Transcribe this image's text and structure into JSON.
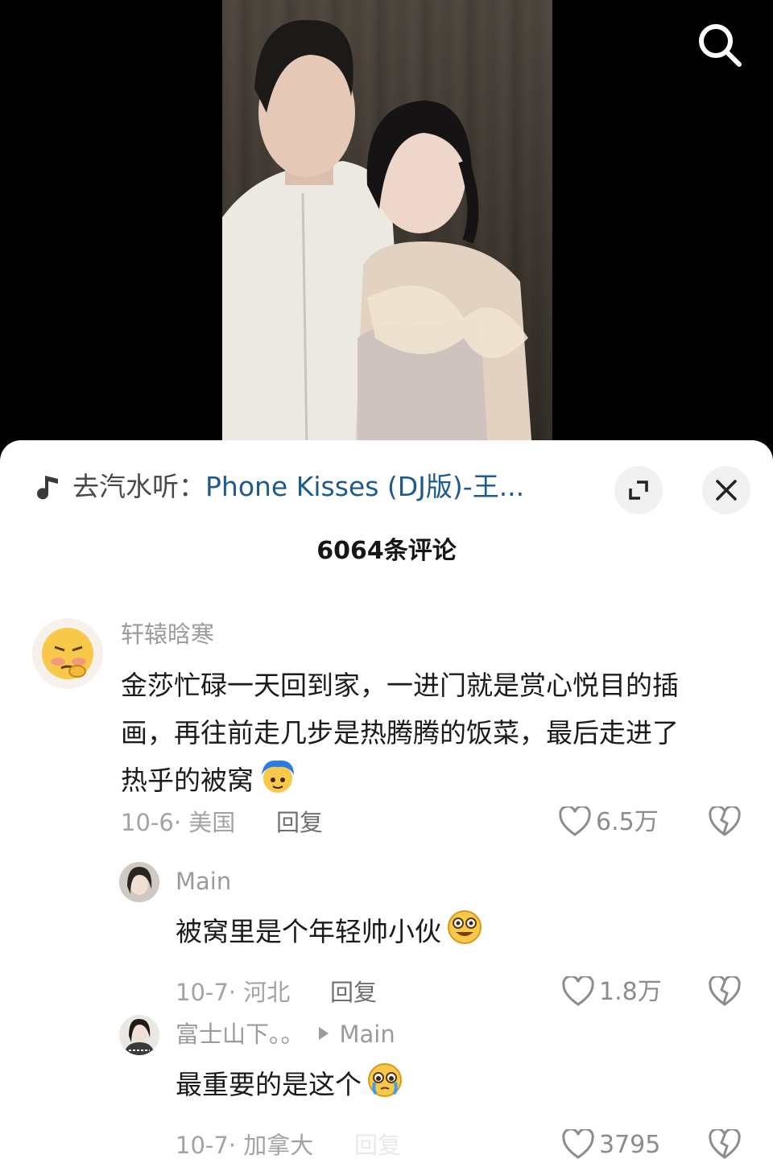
{
  "video": {
    "search_icon": "search-icon"
  },
  "music": {
    "prefix": "去汽水听：",
    "song": "Phone Kisses (DJ版)-王...",
    "icon": "music-note-icon"
  },
  "comments_header": {
    "count_title": "6064条评论"
  },
  "comments": [
    {
      "user": "轩辕晗寒",
      "text_lines": [
        "金莎忙碌一天回到家，一进门就是赏心悦目的插",
        "画，再往前走几步是热腾腾的饭菜，最后走进了",
        "热乎的被窝"
      ],
      "date_location": "10-6· 美国",
      "reply_label": "回复",
      "likes": "6.5万"
    },
    {
      "user": "Main",
      "text": "被窝里是个年轻帅小伙",
      "date_location": "10-7· 河北",
      "reply_label": "回复",
      "likes": "1.8万"
    },
    {
      "user": "富士山下。。",
      "reply_to": "Main",
      "text": "最重要的是这个",
      "date_location": "10-7· 加拿大",
      "reply_label": "回复",
      "likes": "3795"
    }
  ],
  "colors": {
    "song_link": "#1d5a8e",
    "sheet_bg": "#ffffff",
    "muted_text": "#9b9b9b"
  }
}
